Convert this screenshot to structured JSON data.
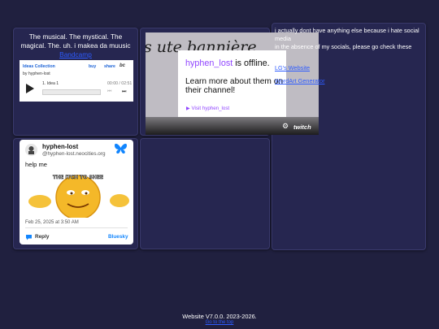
{
  "music": {
    "description": "The musical. The mystical. The magical. The. uh. i makea da muusic",
    "link_label": "Bandcamp"
  },
  "bandcamp_player": {
    "album_title": "Ideas Collection",
    "artist_line": "by hyphen-lost",
    "buy_label": "buy",
    "share_label": "share",
    "logo_text": "bc",
    "current_track": "1. Idea 1",
    "time_display": "00:00 / 02:51",
    "progress": 0
  },
  "twitch": {
    "handwritten": "s ute bannière",
    "channel_name": "hyphen_lost",
    "status_text": " is offline.",
    "learn_more": "Learn more about them on their channel!",
    "visit_label": "Visit hyphen_lost",
    "logo_text": "twitch",
    "accent": "#9146ff"
  },
  "about": {
    "line1": "i actually dont have anything else because i hate social media",
    "line2": "in the absence of my socials, please go check these out:",
    "links": [
      "LG's Website",
      "WordArt Generator"
    ]
  },
  "bluesky": {
    "display_name": "hyphen-lost",
    "handle": "@hyphen-lost.neocities.org",
    "post_text": "help me",
    "meme_caption": "THE ITCH TO SHEE",
    "date": "Feb 25, 2025 at 3:50 AM",
    "reply_label": "Reply",
    "brand_label": "Bluesky",
    "accent": "#1185fe"
  },
  "footer": {
    "version": "Website V7.0.0. 2023-2026.",
    "link_label": "Go to the top"
  },
  "colors": {
    "background": "#20203f",
    "panel": "#262650",
    "link": "#2d5bff"
  }
}
